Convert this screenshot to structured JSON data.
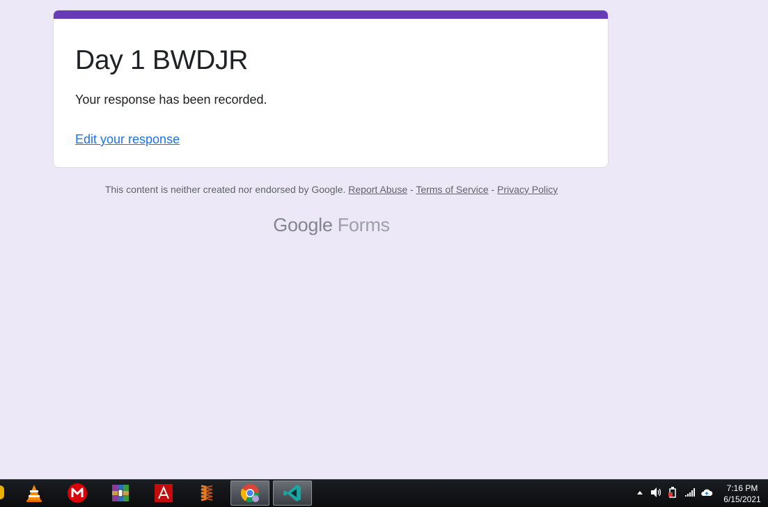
{
  "form": {
    "title": "Day 1 BWDJR",
    "confirmation": "Your response has been recorded.",
    "edit_link": "Edit your response",
    "accent_color": "#673ab7"
  },
  "footer": {
    "disclaimer": "This content is neither created nor endorsed by Google.",
    "report_abuse": "Report Abuse",
    "separator": "-",
    "terms": "Terms of Service",
    "privacy": "Privacy Policy",
    "logo_google": "Google",
    "logo_forms": "Forms"
  },
  "taskbar": {
    "apps": [
      {
        "name": "vlc-icon"
      },
      {
        "name": "mega-icon"
      },
      {
        "name": "winrar-icon"
      },
      {
        "name": "adobe-acrobat-icon"
      },
      {
        "name": "spring-app-icon"
      },
      {
        "name": "chrome-icon"
      },
      {
        "name": "vscode-icon"
      }
    ],
    "tray_icons": [
      "show-hidden-icons-arrow-icon",
      "volume-icon",
      "power-icon",
      "signal-icon",
      "cloud-icon"
    ],
    "time": "7:16 PM",
    "date": "6/15/2021"
  }
}
